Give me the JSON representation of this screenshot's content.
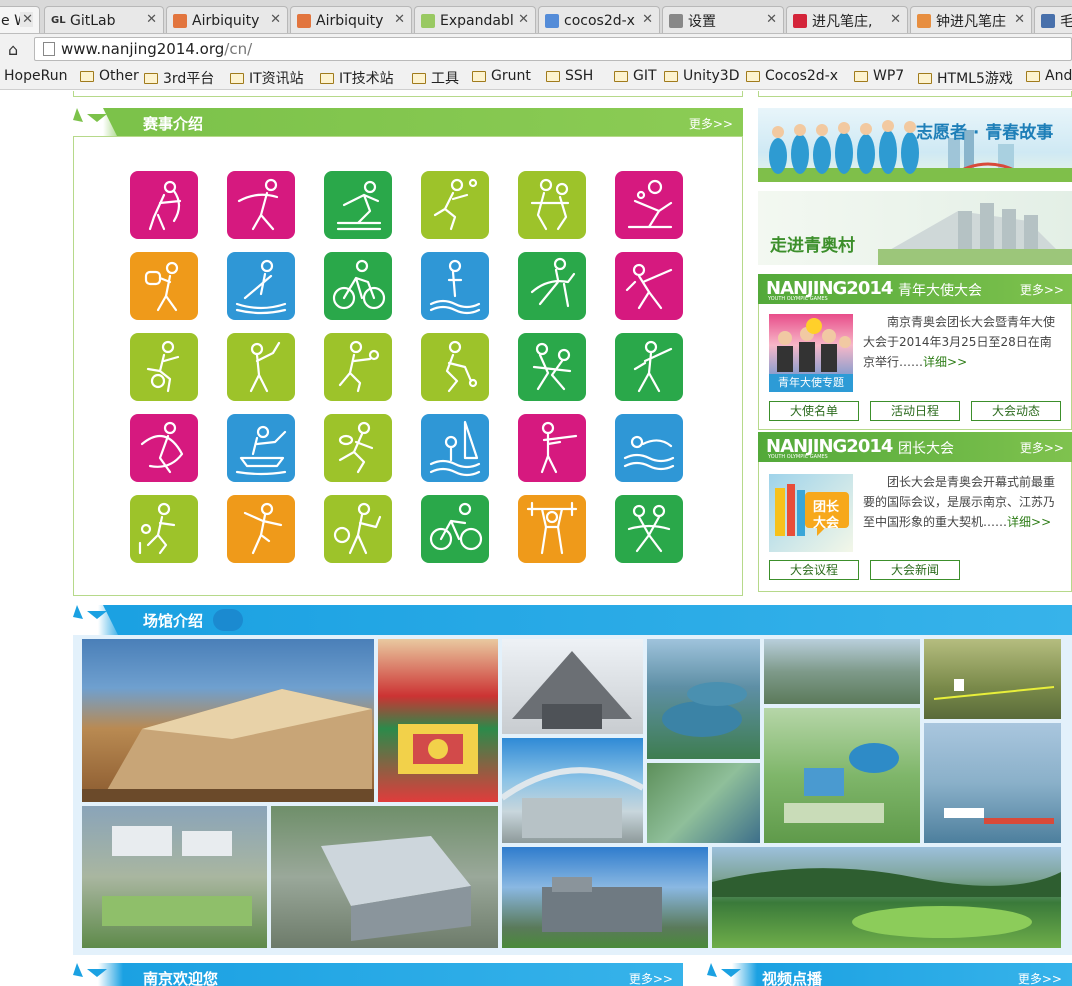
{
  "browser": {
    "tabs": [
      {
        "label": "e W",
        "fav": "",
        "fav_color": "#888888"
      },
      {
        "label": "GitLab",
        "fav": "GL",
        "fav_color": "#333333"
      },
      {
        "label": "Airbiquity",
        "fav": "",
        "fav_color": "#e06020"
      },
      {
        "label": "Airbiquity",
        "fav": "",
        "fav_color": "#e06020"
      },
      {
        "label": "Expandabl",
        "fav": "",
        "fav_color": "#8bc34a"
      },
      {
        "label": "cocos2d-x",
        "fav": "",
        "fav_color": "#3a7bd5"
      },
      {
        "label": "设置",
        "fav": "",
        "fav_color": "#777777"
      },
      {
        "label": "进凡笔庄,",
        "fav": "",
        "fav_color": "#d0021b"
      },
      {
        "label": "钟进凡笔庄",
        "fav": "",
        "fav_color": "#e67e22"
      },
      {
        "label": "毛",
        "fav": "",
        "fav_color": "#2c5aa0"
      }
    ],
    "url_host": "www.nanjing2014.org",
    "url_path": "/cn/",
    "bookmarks": [
      "HopeRun",
      "Other",
      "3rd平台",
      "IT资讯站",
      "IT技术站",
      "工具",
      "Grunt",
      "SSH",
      "GIT",
      "Unity3D",
      "Cocos2d-x",
      "WP7",
      "HTML5游戏",
      "And"
    ]
  },
  "events": {
    "title": "赛事介绍",
    "more": "更多>>",
    "sports": [
      {
        "name": "archery-icon",
        "color": "#d6197f"
      },
      {
        "name": "gymnastics-icon",
        "color": "#d6197f"
      },
      {
        "name": "athletics-icon",
        "color": "#2aa84a"
      },
      {
        "name": "badminton-icon",
        "color": "#9dc32a"
      },
      {
        "name": "basketball-icon",
        "color": "#9dc32a"
      },
      {
        "name": "beach-volleyball-icon",
        "color": "#d6197f"
      },
      {
        "name": "boxing-icon",
        "color": "#ef9a1a"
      },
      {
        "name": "canoe-icon",
        "color": "#2f97d6"
      },
      {
        "name": "cycling-icon",
        "color": "#2aa84a"
      },
      {
        "name": "diving-icon",
        "color": "#2f97d6"
      },
      {
        "name": "equestrian-icon",
        "color": "#2aa84a"
      },
      {
        "name": "fencing-icon",
        "color": "#d6197f"
      },
      {
        "name": "football-icon",
        "color": "#9dc32a"
      },
      {
        "name": "golf-icon",
        "color": "#9dc32a"
      },
      {
        "name": "handball-icon",
        "color": "#9dc32a"
      },
      {
        "name": "hockey-icon",
        "color": "#9dc32a"
      },
      {
        "name": "judo-icon",
        "color": "#2aa84a"
      },
      {
        "name": "modern-pentathlon-icon",
        "color": "#2aa84a"
      },
      {
        "name": "rhythmic-gymnastics-icon",
        "color": "#d6197f"
      },
      {
        "name": "rowing-icon",
        "color": "#2f97d6"
      },
      {
        "name": "rugby-icon",
        "color": "#9dc32a"
      },
      {
        "name": "sailing-icon",
        "color": "#2f97d6"
      },
      {
        "name": "shooting-icon",
        "color": "#d6197f"
      },
      {
        "name": "swimming-icon",
        "color": "#2f97d6"
      },
      {
        "name": "table-tennis-icon",
        "color": "#9dc32a"
      },
      {
        "name": "taekwondo-icon",
        "color": "#ef9a1a"
      },
      {
        "name": "tennis-icon",
        "color": "#9dc32a"
      },
      {
        "name": "triathlon-icon",
        "color": "#2aa84a"
      },
      {
        "name": "weightlifting-icon",
        "color": "#ef9a1a"
      },
      {
        "name": "wrestling-icon",
        "color": "#2aa84a"
      }
    ]
  },
  "sidebar": {
    "volunteer_banner": "志愿者 · 青春故事",
    "village_banner": "走进青奥村",
    "ambassador": {
      "logo": "NANJING2014",
      "logo_sub": "YOUTH OLYMPIC GAMES",
      "title": "青年大使大会",
      "more": "更多>>",
      "text": "南京青奥会团长大会暨青年大使大会于2014年3月25日至28日在南京举行……",
      "detail": "详细>>",
      "photo_caption": "青年大使专题",
      "buttons": [
        "大使名单",
        "活动日程",
        "大会动态"
      ]
    },
    "chef": {
      "logo": "NANJING2014",
      "logo_sub": "YOUTH OLYMPIC GAMES",
      "title": "团长大会",
      "more": "更多>>",
      "text": "团长大会是青奥会开幕式前最重要的国际会议，是展示南京、江苏乃至中国形象的重大契机……",
      "detail": "详细>>",
      "photo_caption": "团长大会",
      "buttons": [
        "大会议程",
        "大会新闻"
      ]
    }
  },
  "venues": {
    "title": "场馆介绍"
  },
  "bottom": {
    "left_title": "南京欢迎您",
    "left_more": "更多>>",
    "right_title": "视频点播",
    "right_more": "更多>>"
  },
  "colors": {
    "green": "#7cc24a",
    "blue": "#1ba1e2",
    "dark_green": "#3c8f2b"
  }
}
